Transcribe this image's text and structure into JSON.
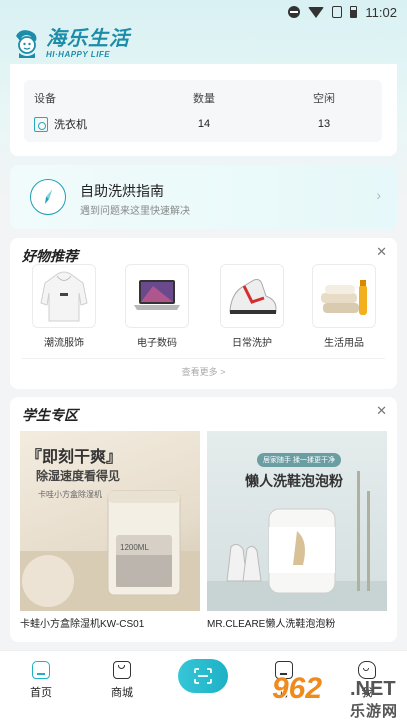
{
  "status_bar": {
    "time": "11:02"
  },
  "header": {
    "logo_cn": "海乐生活",
    "logo_en": "HI·HAPPY LIFE"
  },
  "devices": {
    "columns": [
      "设备",
      "数量",
      "空闲"
    ],
    "rows": [
      {
        "name": "洗衣机",
        "count": "14",
        "idle": "13",
        "icon": "washer-icon"
      }
    ]
  },
  "guide": {
    "title": "自助洗烘指南",
    "subtitle": "遇到问题来这里快速解决",
    "icon": "compass-icon"
  },
  "recommend": {
    "title": "好物推荐",
    "items": [
      {
        "label": "潮流服饰",
        "icon": "hoodie-image"
      },
      {
        "label": "电子数码",
        "icon": "laptop-image"
      },
      {
        "label": "日常洗护",
        "icon": "sneaker-image"
      },
      {
        "label": "生活用品",
        "icon": "towel-image"
      }
    ],
    "see_more": "查看更多 >"
  },
  "student": {
    "title": "学生专区",
    "products": [
      {
        "name": "卡蛙小方盒除湿机KW-CS01",
        "banner_title": "『即刻干爽』",
        "banner_sub": "除湿速度看得见",
        "banner_note": "卡哇小方盒除湿机",
        "capacity": "1200ML"
      },
      {
        "name": "MR.CLEARE懒人洗鞋泡泡粉",
        "banner_tag": "居家随手 揉一揉更干净",
        "banner_title": "懒人洗鞋泡泡粉"
      }
    ]
  },
  "nav": {
    "items": [
      {
        "label": "首页",
        "icon": "home-icon"
      },
      {
        "label": "商城",
        "icon": "shop-bag-icon"
      },
      {
        "label": "",
        "icon": "scan-icon"
      },
      {
        "label": "订",
        "icon": "order-icon"
      },
      {
        "label": "我",
        "icon": "profile-icon"
      }
    ]
  },
  "watermark": {
    "number": "962",
    "suffix": ".NET",
    "cn": "乐游网"
  },
  "colors": {
    "accent": "#1eb0c4",
    "brand": "#1c8da8",
    "watermark": "#f08a1c"
  }
}
